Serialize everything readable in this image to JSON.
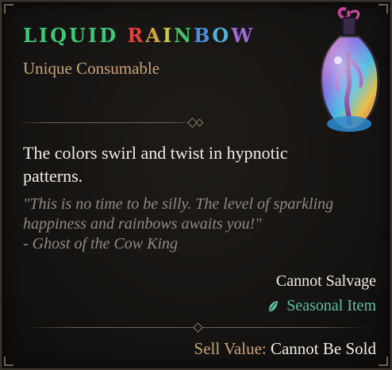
{
  "item": {
    "name_letters": [
      {
        "ch": "L",
        "color": "#3fc77a"
      },
      {
        "ch": "I",
        "color": "#3fc77a"
      },
      {
        "ch": "Q",
        "color": "#3fc77a"
      },
      {
        "ch": "U",
        "color": "#3fc77a"
      },
      {
        "ch": "I",
        "color": "#3fc77a"
      },
      {
        "ch": "D",
        "color": "#3fc77a"
      },
      {
        "ch": " ",
        "color": "#ffffff"
      },
      {
        "ch": "R",
        "color": "#e0433a"
      },
      {
        "ch": "A",
        "color": "#d0a33f"
      },
      {
        "ch": "I",
        "color": "#c9c94a"
      },
      {
        "ch": "N",
        "color": "#46c26a"
      },
      {
        "ch": "B",
        "color": "#4a8ee0"
      },
      {
        "ch": "O",
        "color": "#4fb3d8"
      },
      {
        "ch": "W",
        "color": "#9a6ad6"
      }
    ],
    "type": "Unique Consumable",
    "icon": "liquid-rainbow-potion-icon",
    "description": "The colors swirl and twist in hypnotic patterns.",
    "flavor_lines": [
      "\"This is no time to be silly. The level of sparkling",
      "happiness and rainbows awaits you!\"",
      "- Ghost of the Cow King"
    ],
    "salvage": "Cannot Salvage",
    "seasonal": {
      "label": "Seasonal Item",
      "icon": "leaf-icon",
      "color": "#5fc2a0"
    },
    "sell": {
      "label": "Sell Value:",
      "value": "Cannot Be Sold"
    }
  },
  "colors": {
    "type_text": "#c8a27a",
    "body_text": "#f0ece6",
    "flavor_text": "#8f8a84"
  }
}
